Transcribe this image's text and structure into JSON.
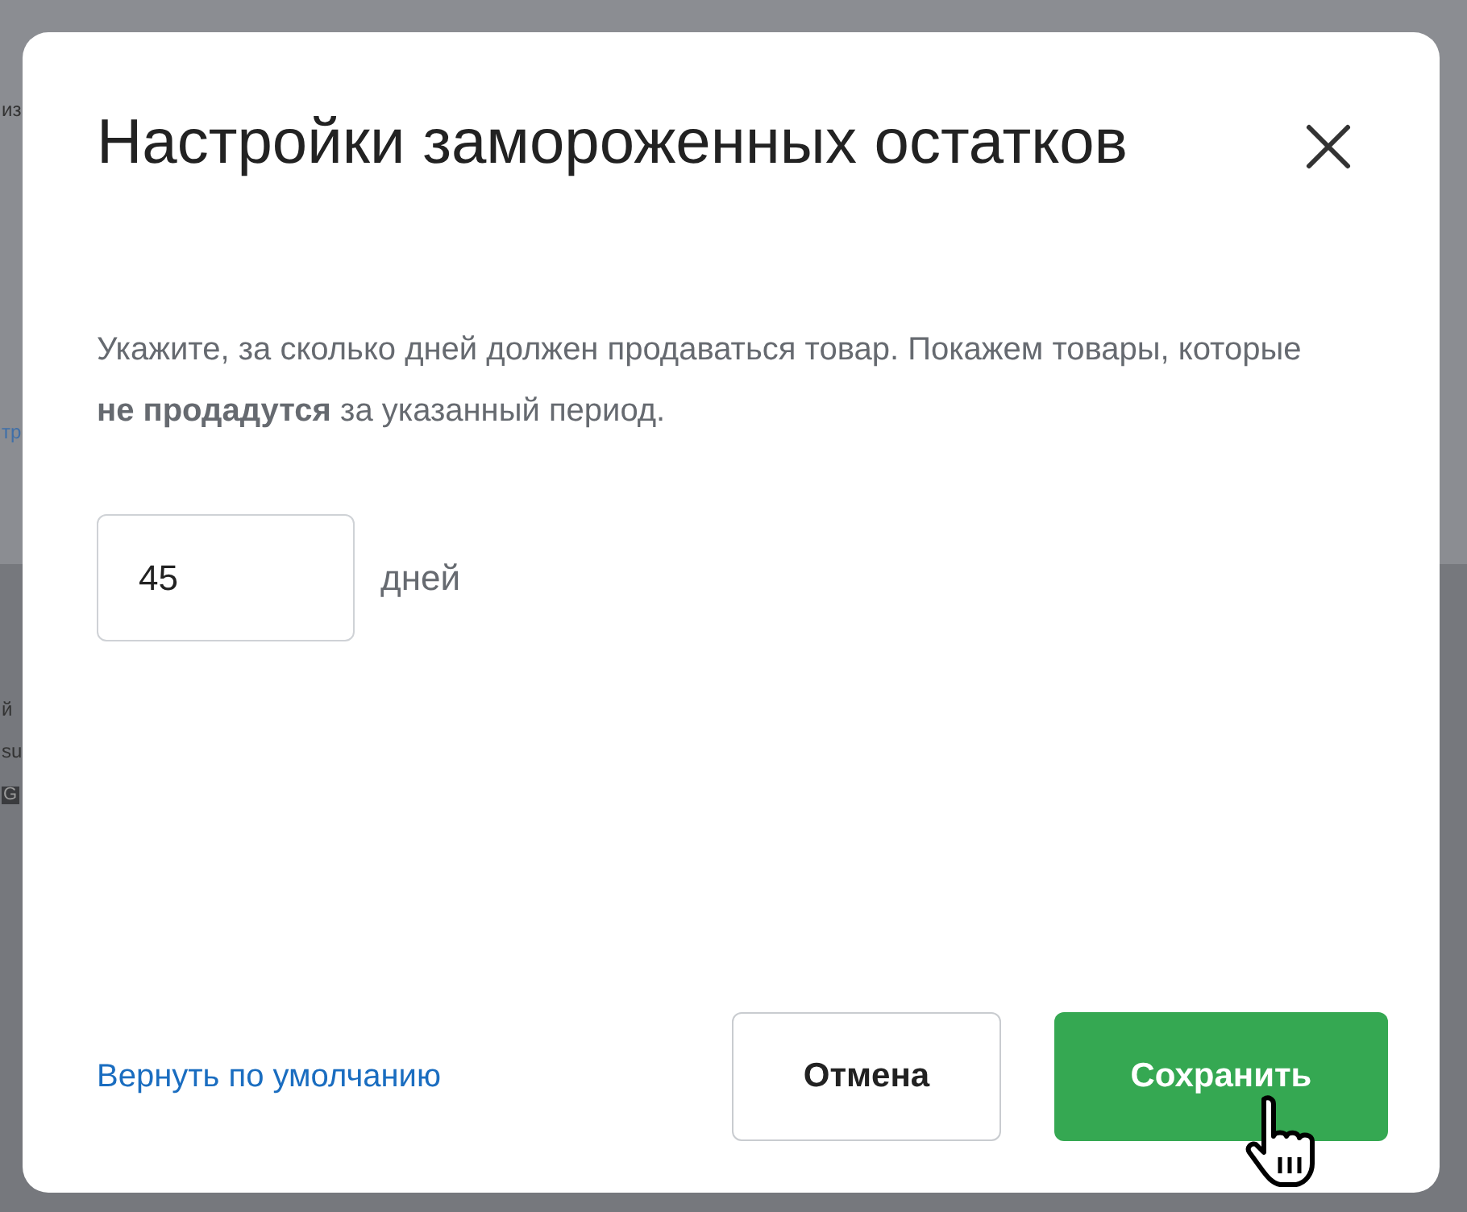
{
  "background": {
    "fragments": [
      {
        "text": "из",
        "kind": "text"
      },
      {
        "text": "тр",
        "kind": "link"
      },
      {
        "text": "й",
        "kind": "text"
      },
      {
        "text": "su",
        "kind": "text"
      },
      {
        "text": "G",
        "kind": "badge"
      }
    ]
  },
  "dialog": {
    "title": "Настройки замороженных остатков",
    "description": "Укажите, за сколько дней должен продаваться товар. Покажем товары, которые **не продадутся** за указанный период.",
    "field": {
      "value": "45",
      "unit": "дней"
    },
    "reset_link": "Вернуть по умолчанию",
    "buttons": [
      {
        "label": "Отмена",
        "kind": "secondary"
      },
      {
        "label": "Сохранить",
        "kind": "primary"
      }
    ]
  }
}
